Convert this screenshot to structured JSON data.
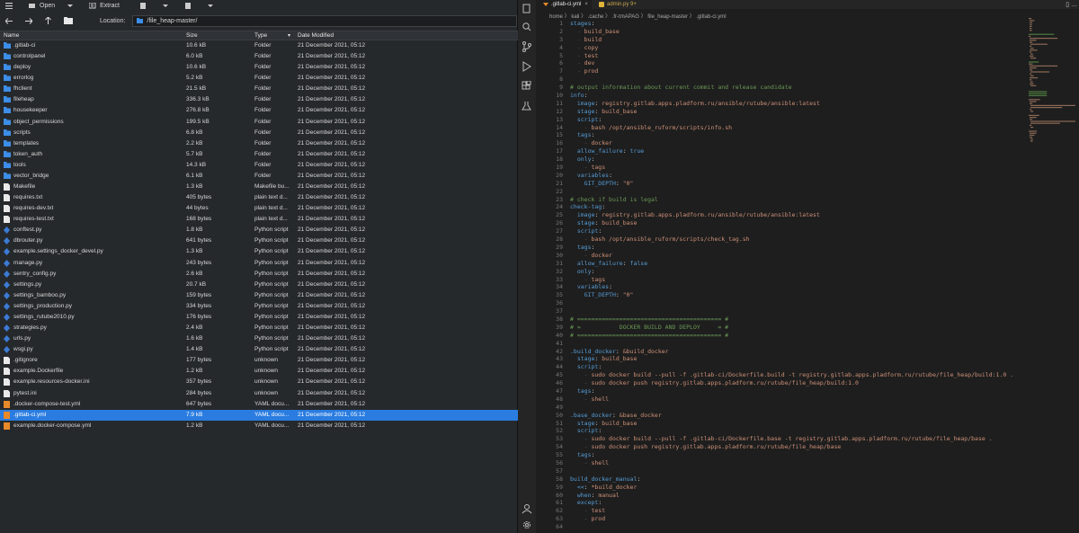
{
  "archive": {
    "toolbar": {
      "open": "Open",
      "extract": "Extract"
    },
    "location_label": "Location:",
    "location_path": "/file_heap-master/",
    "columns": {
      "name": "Name",
      "size": "Size",
      "type": "Type",
      "date": "Date Modified"
    },
    "rows": [
      {
        "name": ".gitlab-ci",
        "size": "10.6 kB",
        "type": "Folder",
        "date": "21 December 2021, 05:12",
        "icon": "folder"
      },
      {
        "name": "controlpanel",
        "size": "6.0 kB",
        "type": "Folder",
        "date": "21 December 2021, 05:12",
        "icon": "folder"
      },
      {
        "name": "deploy",
        "size": "10.6 kB",
        "type": "Folder",
        "date": "21 December 2021, 05:12",
        "icon": "folder"
      },
      {
        "name": "errorlog",
        "size": "5.2 kB",
        "type": "Folder",
        "date": "21 December 2021, 05:12",
        "icon": "folder"
      },
      {
        "name": "fhclient",
        "size": "21.5 kB",
        "type": "Folder",
        "date": "21 December 2021, 05:12",
        "icon": "folder"
      },
      {
        "name": "fileheap",
        "size": "336.3 kB",
        "type": "Folder",
        "date": "21 December 2021, 05:12",
        "icon": "folder"
      },
      {
        "name": "housekeeper",
        "size": "276.8 kB",
        "type": "Folder",
        "date": "21 December 2021, 05:12",
        "icon": "folder"
      },
      {
        "name": "object_permissions",
        "size": "199.5 kB",
        "type": "Folder",
        "date": "21 December 2021, 05:12",
        "icon": "folder"
      },
      {
        "name": "scripts",
        "size": "6.8 kB",
        "type": "Folder",
        "date": "21 December 2021, 05:12",
        "icon": "folder"
      },
      {
        "name": "templates",
        "size": "2.2 kB",
        "type": "Folder",
        "date": "21 December 2021, 05:12",
        "icon": "folder"
      },
      {
        "name": "token_auth",
        "size": "5.7 kB",
        "type": "Folder",
        "date": "21 December 2021, 05:12",
        "icon": "folder"
      },
      {
        "name": "tools",
        "size": "14.3 kB",
        "type": "Folder",
        "date": "21 December 2021, 05:12",
        "icon": "folder"
      },
      {
        "name": "vector_bridge",
        "size": "6.1 kB",
        "type": "Folder",
        "date": "21 December 2021, 05:12",
        "icon": "folder"
      },
      {
        "name": "Makefile",
        "size": "1.3 kB",
        "type": "Makefile bu...",
        "date": "21 December 2021, 05:12",
        "icon": "text"
      },
      {
        "name": "requires.txt",
        "size": "405 bytes",
        "type": "plain text d...",
        "date": "21 December 2021, 05:12",
        "icon": "text"
      },
      {
        "name": "requires-dev.txt",
        "size": "44 bytes",
        "type": "plain text d...",
        "date": "21 December 2021, 05:12",
        "icon": "text"
      },
      {
        "name": "requires-test.txt",
        "size": "168 bytes",
        "type": "plain text d...",
        "date": "21 December 2021, 05:12",
        "icon": "text"
      },
      {
        "name": "conftest.py",
        "size": "1.8 kB",
        "type": "Python script",
        "date": "21 December 2021, 05:12",
        "icon": "python"
      },
      {
        "name": "dbrouter.py",
        "size": "641 bytes",
        "type": "Python script",
        "date": "21 December 2021, 05:12",
        "icon": "python"
      },
      {
        "name": "example.settings_docker_devel.py",
        "size": "1.3 kB",
        "type": "Python script",
        "date": "21 December 2021, 05:12",
        "icon": "python"
      },
      {
        "name": "manage.py",
        "size": "243 bytes",
        "type": "Python script",
        "date": "21 December 2021, 05:12",
        "icon": "python"
      },
      {
        "name": "sentry_config.py",
        "size": "2.6 kB",
        "type": "Python script",
        "date": "21 December 2021, 05:12",
        "icon": "python"
      },
      {
        "name": "settings.py",
        "size": "20.7 kB",
        "type": "Python script",
        "date": "21 December 2021, 05:12",
        "icon": "python"
      },
      {
        "name": "settings_bamboo.py",
        "size": "159 bytes",
        "type": "Python script",
        "date": "21 December 2021, 05:12",
        "icon": "python"
      },
      {
        "name": "settings_production.py",
        "size": "334 bytes",
        "type": "Python script",
        "date": "21 December 2021, 05:12",
        "icon": "python"
      },
      {
        "name": "settings_rutube2010.py",
        "size": "176 bytes",
        "type": "Python script",
        "date": "21 December 2021, 05:12",
        "icon": "python"
      },
      {
        "name": "strategies.py",
        "size": "2.4 kB",
        "type": "Python script",
        "date": "21 December 2021, 05:12",
        "icon": "python"
      },
      {
        "name": "urls.py",
        "size": "1.6 kB",
        "type": "Python script",
        "date": "21 December 2021, 05:12",
        "icon": "python"
      },
      {
        "name": "wsgi.py",
        "size": "1.4 kB",
        "type": "Python script",
        "date": "21 December 2021, 05:12",
        "icon": "python"
      },
      {
        "name": ".gitignore",
        "size": "177 bytes",
        "type": "unknown",
        "date": "21 December 2021, 05:12",
        "icon": "blank"
      },
      {
        "name": "example.Dockerfile",
        "size": "1.2 kB",
        "type": "unknown",
        "date": "21 December 2021, 05:12",
        "icon": "blank"
      },
      {
        "name": "example.resources-docker.ini",
        "size": "357 bytes",
        "type": "unknown",
        "date": "21 December 2021, 05:12",
        "icon": "blank"
      },
      {
        "name": "pytest.ini",
        "size": "284 bytes",
        "type": "unknown",
        "date": "21 December 2021, 05:12",
        "icon": "blank"
      },
      {
        "name": ".docker-compose-test.yml",
        "size": "647 bytes",
        "type": "YAML docu...",
        "date": "21 December 2021, 05:12",
        "icon": "yaml"
      },
      {
        "name": ".gitlab-ci.yml",
        "size": "7.9 kB",
        "type": "YAML docu...",
        "date": "21 December 2021, 05:12",
        "icon": "yaml",
        "selected": true
      },
      {
        "name": "example.docker-compose.yml",
        "size": "1.2 kB",
        "type": "YAML docu...",
        "date": "21 December 2021, 05:12",
        "icon": "yaml"
      }
    ]
  },
  "editor": {
    "tabs": [
      {
        "label": ".gitlab-ci.yml"
      },
      {
        "label": "admin.py 9+"
      }
    ],
    "breadcrumb": "home 〉 kali 〉 .cache 〉 .fr-tmAPAG 〉 file_heap-master 〉 .gitlab-ci.yml",
    "lines": [
      "stages:",
      "  - build_base",
      "  - build",
      "  - copy",
      "  - test",
      "  - dev",
      "  - prod",
      "",
      "# output information about current commit and release candidate",
      "info:",
      "  image: registry.gitlab.apps.pladform.ru/ansible/rutube/ansible:latest",
      "  stage: build_base",
      "  script:",
      "    - bash /opt/ansible_ruform/scripts/info.sh",
      "  tags:",
      "    - docker",
      "  allow_failure: true",
      "  only:",
      "    - tags",
      "  variables:",
      "    GIT_DEPTH: \"0\"",
      "",
      "# check if build is legal",
      "check-tag:",
      "  image: registry.gitlab.apps.pladform.ru/ansible/rutube/ansible:latest",
      "  stage: build_base",
      "  script:",
      "    - bash /opt/ansible_ruform/scripts/check_tag.sh",
      "  tags:",
      "    - docker",
      "  allow_failure: false",
      "  only:",
      "    - tags",
      "  variables:",
      "    GIT_DEPTH: \"0\"",
      "",
      "",
      "# ========================================= #",
      "# =           DOCKER BUILD AND DEPLOY     = #",
      "# ========================================= #",
      "",
      ".build_docker: &build_docker",
      "  stage: build_base",
      "  script:",
      "    - sudo docker build --pull -f .gitlab-ci/Dockerfile.build -t registry.gitlab.apps.pladform.ru/rutube/file_heap/build:1.0 .",
      "    - sudo docker push registry.gitlab.apps.pladform.ru/rutube/file_heap/build:1.0",
      "  tags:",
      "    - shell",
      "",
      ".base_docker: &base_docker",
      "  stage: build_base",
      "  script:",
      "    - sudo docker build --pull -f .gitlab-ci/Dockerfile.base -t registry.gitlab.apps.pladform.ru/rutube/file_heap/base .",
      "    - sudo docker push registry.gitlab.apps.pladform.ru/rutube/file_heap/base",
      "  tags:",
      "    - shell",
      "",
      "build_docker_manual:",
      "  <<: *build_docker",
      "  when: manual",
      "  except:",
      "    - test",
      "    - prod",
      ""
    ]
  },
  "colors": {
    "selection": "#2a7ce0",
    "folder": "#3d8ee8",
    "yaml": "#e8892a",
    "python": "#3c7bd6"
  }
}
